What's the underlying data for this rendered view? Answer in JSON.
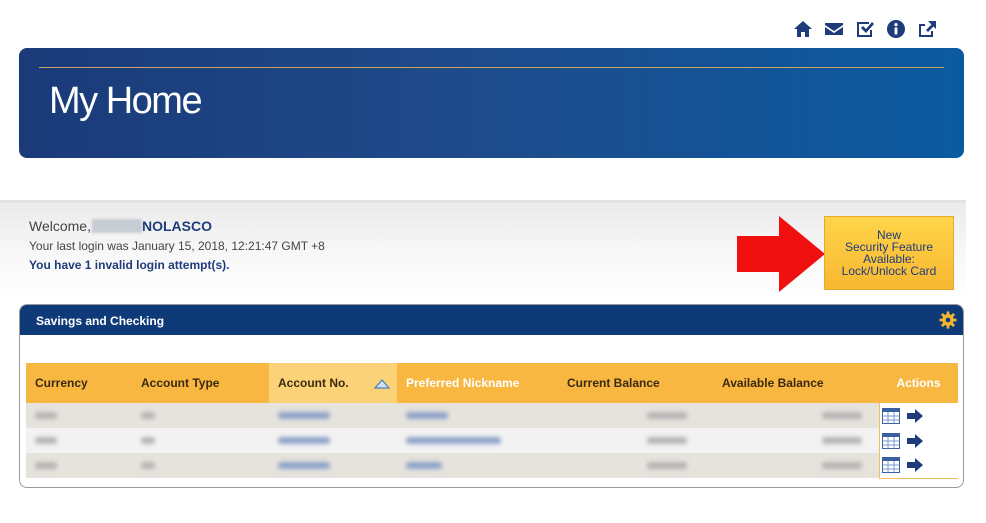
{
  "top_nav": {
    "icons": [
      "home-icon",
      "mail-icon",
      "checklist-icon",
      "info-icon",
      "share-icon"
    ]
  },
  "banner": {
    "title": "My Home"
  },
  "welcome": {
    "greeting": "Welcome,",
    "last_name": "NOLASCO",
    "last_login": "Your last login was January 15, 2018, 12:21:47 GMT +8",
    "invalid_attempts": "You have 1 invalid login attempt(s)."
  },
  "promo": {
    "line1": "New",
    "line2": "Security Feature",
    "line3": "Available:",
    "line4": "Lock/Unlock Card"
  },
  "accounts_panel": {
    "title": "Savings and Checking",
    "columns": [
      "Currency",
      "Account Type",
      "Account No.",
      "Preferred Nickname",
      "Current Balance",
      "Available Balance",
      "Actions"
    ],
    "sorted_column": "Account No.",
    "sort_direction": "ascending",
    "rows_count_note": "",
    "colors": {
      "header": "#0e3a78",
      "table_header": "#f8b741",
      "accent": "#1e3c7a"
    }
  }
}
